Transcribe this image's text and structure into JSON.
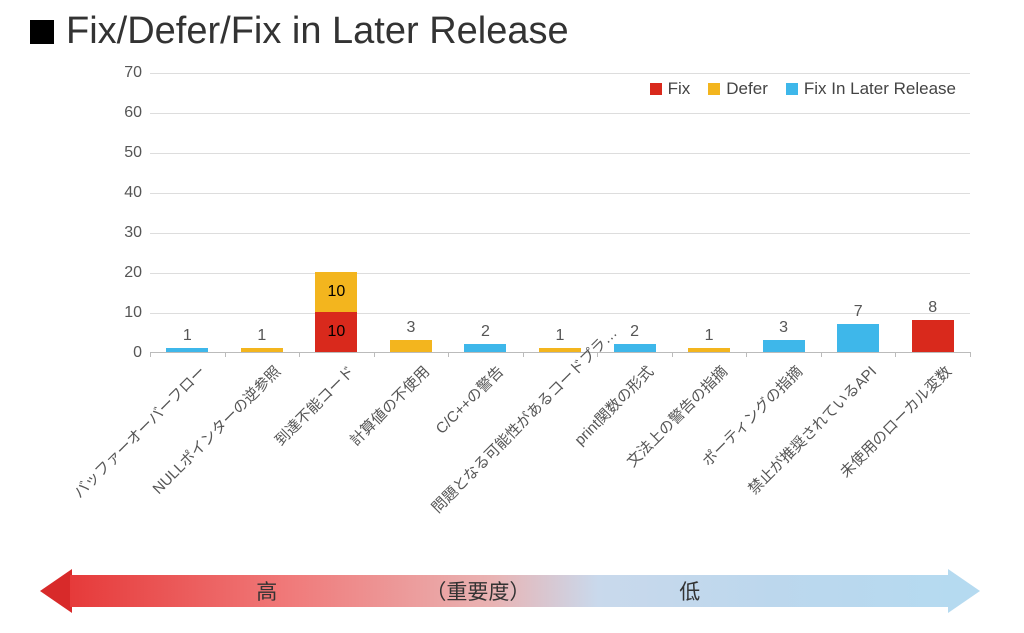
{
  "title": "Fix/Defer/Fix in Later Release",
  "legend": {
    "fix": "Fix",
    "defer": "Defer",
    "later": "Fix In Later Release"
  },
  "colors": {
    "fix": "#d9291c",
    "defer": "#f3b51e",
    "later": "#3eb7ea"
  },
  "priority": {
    "high": "高",
    "mid": "（重要度）",
    "low": "低"
  },
  "chart_data": {
    "type": "bar",
    "stacked": true,
    "ylabel": "",
    "xlabel": "",
    "ylim": [
      0,
      70
    ],
    "yticks": [
      0,
      10,
      20,
      30,
      40,
      50,
      60,
      70
    ],
    "categories": [
      "バッファーオーバーフロー",
      "NULLポインターの逆参照",
      "到達不能コード",
      "計算値の不使用",
      "C/C++の警告",
      "問題となる可能性があるコードプラ…",
      "print関数の形式",
      "文法上の警告の指摘",
      "ポーティングの指摘",
      "禁止が推奨されているAPI",
      "未使用のローカル変数"
    ],
    "series": [
      {
        "name": "Fix",
        "key": "fix",
        "values": [
          0,
          0,
          10,
          0,
          0,
          0,
          0,
          0,
          0,
          0,
          8
        ]
      },
      {
        "name": "Defer",
        "key": "defer",
        "values": [
          0,
          1,
          10,
          3,
          0,
          1,
          0,
          1,
          0,
          0,
          0
        ]
      },
      {
        "name": "Fix In Later Release",
        "key": "later",
        "values": [
          1,
          0,
          0,
          0,
          2,
          0,
          2,
          0,
          3,
          7,
          0
        ]
      }
    ],
    "top_labels": [
      1,
      1,
      null,
      3,
      2,
      1,
      2,
      1,
      3,
      7,
      8
    ],
    "inside_labels": {
      "2": {
        "fix": 10,
        "defer": 10
      }
    }
  }
}
